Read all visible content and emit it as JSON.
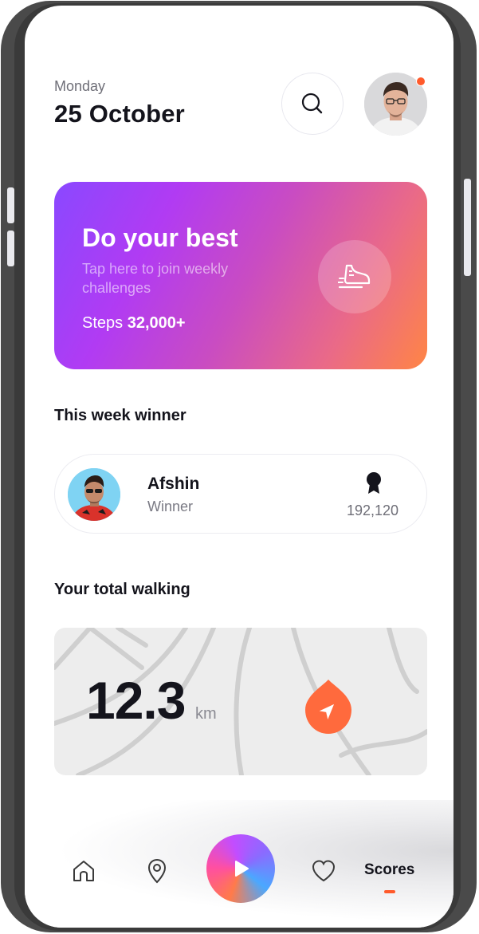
{
  "header": {
    "day": "Monday",
    "date": "25 October"
  },
  "icons": {
    "search": "search-icon",
    "avatar": "user-avatar",
    "notification": "notification-dot",
    "shoe": "running-shoe-icon",
    "medal": "medal-icon",
    "map_pin": "location-pin-icon",
    "home": "home-icon",
    "location": "location-icon",
    "play": "play-icon",
    "heart": "heart-icon"
  },
  "promo": {
    "title": "Do your best",
    "subtitle": "Tap here to join weekly challenges",
    "steps_label": "Steps",
    "steps_value": "32,000+"
  },
  "winner_section": {
    "title": "This week winner",
    "name": "Afshin",
    "role": "Winner",
    "score": "192,120"
  },
  "walking_section": {
    "title": "Your total walking",
    "value": "12.3",
    "unit": "km"
  },
  "bottom_nav": {
    "scores_label": "Scores"
  },
  "colors": {
    "accent": "#ff5a2b",
    "text_primary": "#14141c",
    "text_secondary": "#7a7a84",
    "promo_gradient_start": "#8a48ff",
    "promo_gradient_end": "#ff8545"
  }
}
